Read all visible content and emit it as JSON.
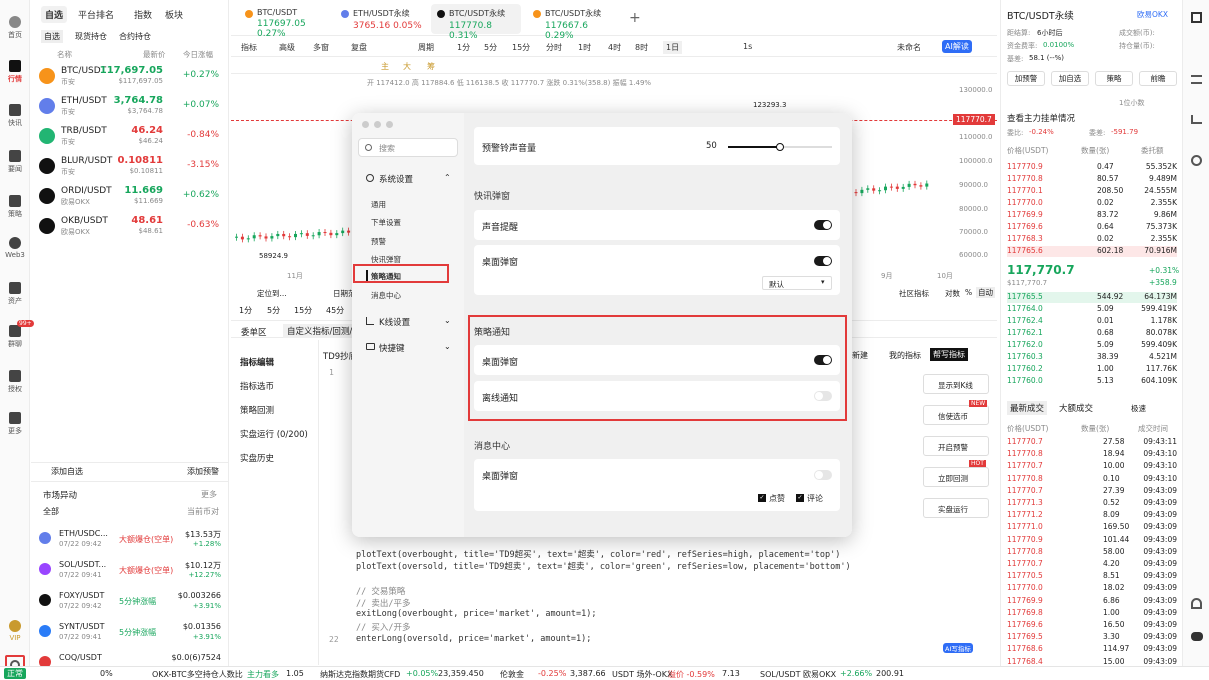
{
  "leftnav": {
    "items": [
      "首页",
      "行情",
      "快讯",
      "要闻",
      "策略",
      "Web3",
      "资产",
      "群聊",
      "授权",
      "更多"
    ],
    "vip": "VIP",
    "badge": "99+"
  },
  "market": {
    "tabs": [
      "自选",
      "平台排名",
      "指数",
      "板块"
    ],
    "subtabs": [
      "自选",
      "现货持仓",
      "合约持仓"
    ],
    "headers": [
      "名称",
      "最新价",
      "今日涨幅"
    ],
    "coins": [
      {
        "name": "BTC/USDT",
        "ex": "币安",
        "price": "117,697.05",
        "sub": "$117,697.05",
        "chg": "+0.27%",
        "up": true,
        "color": "#f7931a"
      },
      {
        "name": "ETH/USDT",
        "ex": "币安",
        "price": "3,764.78",
        "sub": "$3,764.78",
        "chg": "+0.07%",
        "up": true,
        "color": "#627eea"
      },
      {
        "name": "TRB/USDT",
        "ex": "币安",
        "price": "46.24",
        "sub": "$46.24",
        "chg": "-0.84%",
        "up": false,
        "color": "#22b573"
      },
      {
        "name": "BLUR/USDT",
        "ex": "币安",
        "price": "0.10811",
        "sub": "$0.10811",
        "chg": "-3.15%",
        "up": false,
        "color": "#111"
      },
      {
        "name": "ORDI/USDT",
        "ex": "欧易OKX",
        "price": "11.669",
        "sub": "$11.669",
        "chg": "+0.62%",
        "up": true,
        "color": "#111"
      },
      {
        "name": "OKB/USDT",
        "ex": "欧易OKX",
        "price": "48.61",
        "sub": "$48.61",
        "chg": "-0.63%",
        "up": false,
        "color": "#111"
      }
    ],
    "add_fav": "添加自选",
    "add_alert": "添加预警",
    "alerts_title": "市场异动",
    "more": "更多",
    "all": "全部",
    "current": "当前币对",
    "alerts": [
      {
        "name": "ETH/USDC...",
        "time": "07/22 09:42",
        "tag": "大额爆仓(空单)",
        "v": "$13.53万",
        "p": "+1.28%",
        "color": "#627eea"
      },
      {
        "name": "SOL/USDT...",
        "time": "07/22 09:41",
        "tag": "大额爆仓(空单)",
        "v": "$10.12万",
        "p": "+12.27%",
        "color": "#9945ff"
      },
      {
        "name": "FOXY/USDT",
        "time": "07/22 09:42",
        "tag": "5分钟涨幅",
        "v": "$0.003266",
        "p": "+3.91%",
        "color": "#111"
      },
      {
        "name": "SYNT/USDT",
        "time": "07/22 09:41",
        "tag": "5分钟涨幅",
        "v": "$0.01356",
        "p": "+3.91%",
        "color": "#2a7cf7"
      },
      {
        "name": "COQ/USDT",
        "time": "",
        "tag": "",
        "v": "$0.0(6)7524",
        "p": "",
        "color": "#e23a3a"
      }
    ]
  },
  "tabs": [
    {
      "t": "BTC/USDT",
      "s": "117697.05 0.27%",
      "up": true,
      "color": "#f7931a"
    },
    {
      "t": "ETH/USDT永续",
      "s": "3765.16 0.05%",
      "up": false,
      "color": "#627eea"
    },
    {
      "t": "BTC/USDT永续",
      "s": "117770.8 0.31%",
      "up": true,
      "color": "#111"
    },
    {
      "t": "BTC/USDT永续",
      "s": "117667.6 0.29%",
      "up": true,
      "color": "#f7931a"
    }
  ],
  "toolbar": {
    "items": [
      "指标",
      "高级",
      "多窗",
      "复盘",
      "周期",
      "1分",
      "5分",
      "15分",
      "分时",
      "1时",
      "4时",
      "8时",
      "1日",
      "1s"
    ],
    "unnamed": "未命名",
    "ai": "AI解读"
  },
  "chart": {
    "ohlc": "开 117412.0 高 117884.6 低 116138.5 收 117770.7 涨跌 0.31%(358.8) 振幅 1.49%",
    "yticks": [
      "130000.0",
      "110000.0",
      "100000.0",
      "90000.0",
      "80000.0",
      "70000.0",
      "60000.0"
    ],
    "last": "117770.7",
    "high": "123293.3",
    "low": "58924.9",
    "xticks": [
      "11月",
      "9月",
      "10月"
    ],
    "bottom": [
      "定位到...",
      "日期范围",
      "社区指标",
      "对数",
      "%",
      "自动"
    ],
    "periods": [
      "1分",
      "5分",
      "15分",
      "45分"
    ],
    "drawtools": [
      "主",
      "大",
      "筹"
    ]
  },
  "editor": {
    "tabs": [
      "委单区",
      "自定义指标/回测/"
    ],
    "side": [
      "指标编辑",
      "指标选币",
      "策略回测",
      "实盘运行 (0/200)",
      "实盘历史"
    ],
    "file": "TD9抄底",
    "lines": [
      {
        "n": "1",
        "t": ""
      },
      {
        "n": "",
        "t": "plotText(overbought, title='TD9超买', text='超卖', color='red', refSeries=high, placement='top')"
      },
      {
        "n": "",
        "t": "plotText(oversold, title='TD9超卖', text='超卖', color='green', refSeries=low, placement='bottom')"
      },
      {
        "n": "",
        "t": ""
      },
      {
        "n": "",
        "t": "// 交易策略"
      },
      {
        "n": "",
        "t": "// 卖出/平多"
      },
      {
        "n": "",
        "t": "exitLong(overbought, price='market', amount=1);"
      },
      {
        "n": "",
        "t": "// 买入/开多"
      },
      {
        "n": "22",
        "t": "enterLong(oversold, price='market', amount=1);"
      }
    ],
    "right_tabs": [
      "新建",
      "我的指标",
      "帮写指标"
    ],
    "buttons": [
      "显示到K线",
      "信使选币",
      "开启预警",
      "立即回测",
      "实盘运行"
    ],
    "new": "NEW",
    "hot": "HOT",
    "ai": "AI写指标"
  },
  "book": {
    "title": "BTC/USDT永续",
    "okx": "欧易OKX",
    "info": [
      [
        "距结算:",
        "6小时后"
      ],
      [
        "资金费率:",
        "0.0100%"
      ],
      [
        "基差:",
        "58.1 (--%)"
      ]
    ],
    "info_r": [
      [
        "成交额(币):",
        "--"
      ],
      [
        "持仓量(币):",
        "--"
      ]
    ],
    "buttons": [
      "加预警",
      "加自选",
      "策略",
      "前瞻"
    ],
    "unit": "1位小数",
    "depth_title": "查看主力挂单情况",
    "wei_bi": "委比:",
    "wei_bi_v": "-0.24%",
    "wei_cha": "委差:",
    "wei_cha_v": "-591.79",
    "cols": [
      "价格(USDT)",
      "数量(张)",
      "委托额"
    ],
    "asks": [
      [
        "117770.9",
        "0.47",
        "55.352K"
      ],
      [
        "117770.8",
        "80.57",
        "9.489M"
      ],
      [
        "117770.1",
        "208.50",
        "24.555M"
      ],
      [
        "117770.0",
        "0.02",
        "2.355K"
      ],
      [
        "117769.9",
        "83.72",
        "9.86M"
      ],
      [
        "117769.6",
        "0.64",
        "75.373K"
      ],
      [
        "117768.3",
        "0.02",
        "2.355K"
      ],
      [
        "117765.6",
        "602.18",
        "70.916M"
      ]
    ],
    "mid": "117,770.7",
    "mid_sub": "$117,770.7",
    "mid_chg": "+0.31%",
    "mid_diff": "+358.9",
    "bids": [
      [
        "117765.5",
        "544.92",
        "64.173M"
      ],
      [
        "117764.0",
        "5.09",
        "599.419K"
      ],
      [
        "117762.4",
        "0.01",
        "1.178K"
      ],
      [
        "117762.1",
        "0.68",
        "80.078K"
      ],
      [
        "117762.0",
        "5.09",
        "599.409K"
      ],
      [
        "117760.3",
        "38.39",
        "4.521M"
      ],
      [
        "117760.2",
        "1.00",
        "117.76K"
      ],
      [
        "117760.0",
        "5.13",
        "604.109K"
      ]
    ],
    "trades_tabs": [
      "最新成交",
      "大额成交"
    ],
    "trades_opt": "极速",
    "trade_cols": [
      "价格(USDT)",
      "数量(张)",
      "成交时间"
    ],
    "trades": [
      [
        "117770.7",
        "27.58",
        "09:43:11"
      ],
      [
        "117770.8",
        "18.94",
        "09:43:10"
      ],
      [
        "117770.7",
        "10.00",
        "09:43:10"
      ],
      [
        "117770.8",
        "0.10",
        "09:43:10"
      ],
      [
        "117770.7",
        "27.39",
        "09:43:09"
      ],
      [
        "117771.3",
        "0.52",
        "09:43:09"
      ],
      [
        "117771.2",
        "8.09",
        "09:43:09"
      ],
      [
        "117771.0",
        "169.50",
        "09:43:09"
      ],
      [
        "117770.9",
        "101.44",
        "09:43:09"
      ],
      [
        "117770.8",
        "58.00",
        "09:43:09"
      ],
      [
        "117770.7",
        "4.20",
        "09:43:09"
      ],
      [
        "117770.5",
        "8.51",
        "09:43:09"
      ],
      [
        "117770.0",
        "18.02",
        "09:43:09"
      ],
      [
        "117769.9",
        "6.86",
        "09:43:09"
      ],
      [
        "117769.8",
        "1.00",
        "09:43:09"
      ],
      [
        "117769.6",
        "16.50",
        "09:43:09"
      ],
      [
        "117769.5",
        "3.30",
        "09:43:09"
      ],
      [
        "117768.6",
        "114.97",
        "09:43:09"
      ],
      [
        "117768.4",
        "15.00",
        "09:43:09"
      ]
    ]
  },
  "ticker": {
    "status": "正常",
    "zero": "0%",
    "items": [
      [
        "OKX-BTC多空持仓人数比",
        "主力看多",
        "1.05"
      ],
      [
        "纳斯达克指数期货CFD",
        "+0.05%",
        "23,359.450"
      ],
      [
        "伦敦金",
        "-0.25%",
        "3,387.66"
      ],
      [
        "USDT 场外-OKX",
        "溢价 -0.59%",
        "7.13"
      ],
      [
        "SOL/USDT 欧易OKX",
        "+2.66%",
        "200.91"
      ]
    ]
  },
  "modal": {
    "search": "搜索",
    "system": "系统设置",
    "sublinks": [
      "通用",
      "下单设置",
      "预警",
      "快讯弹窗",
      "策略通知",
      "消息中心"
    ],
    "kline": "K线设置",
    "shortcut": "快捷键",
    "volume_label": "预警铃声音量",
    "volume": 50,
    "news_popup": "快讯弹窗",
    "sound": "声音提醒",
    "desktop_popup": "桌面弹窗",
    "default": "默认",
    "strategy": "策略通知",
    "strategy_desktop": "桌面弹窗",
    "offline": "离线通知",
    "message": "消息中心",
    "msg_desktop": "桌面弹窗",
    "like": "点赞",
    "comment": "评论"
  }
}
